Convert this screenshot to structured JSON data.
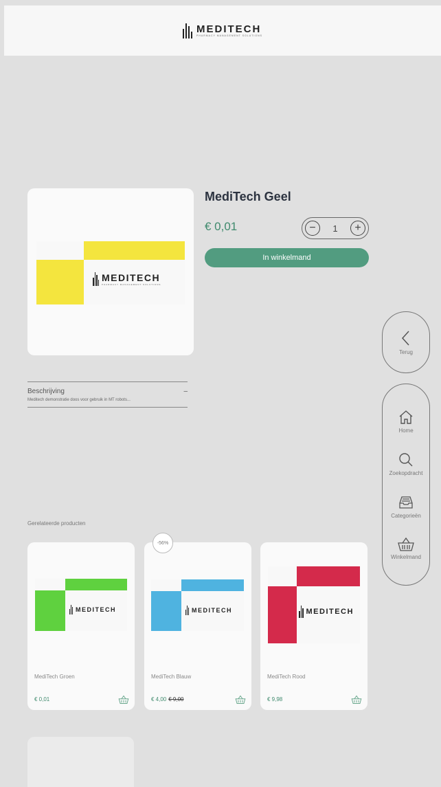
{
  "header": {
    "brand": "MEDITECH",
    "tagline": "PHARMACY MANAGEMENT SOLUTIONS"
  },
  "product": {
    "title": "MediTech Geel",
    "price": "€ 0,01",
    "quantity": "1",
    "add_to_cart_label": "In winkelmand",
    "box_brand": "MEDITECH",
    "box_tagline": "PHARMACY MANAGEMENT SOLUTIONS",
    "accent_color": "#f4e53e"
  },
  "description": {
    "heading": "Beschrijving",
    "toggle": "–",
    "text": "Meditech demonstratie doos voor gebruik in MT robots..."
  },
  "side_nav": {
    "back": {
      "label": "Terug",
      "icon": "chevron-left-icon"
    },
    "items": [
      {
        "label": "Home",
        "icon": "home-icon"
      },
      {
        "label": "Zoekopdracht",
        "icon": "search-icon"
      },
      {
        "label": "Categorieën",
        "icon": "inbox-icon"
      },
      {
        "label": "Winkelmand",
        "icon": "basket-icon"
      }
    ]
  },
  "related": {
    "title": "Gerelateerde producten",
    "discount_badge": "-56%",
    "items": [
      {
        "name": "MediTech Groen",
        "price": "€ 0,01",
        "old_price": "",
        "color": "#5fd13f"
      },
      {
        "name": "MediTech Blauw",
        "price": "€ 4,00",
        "old_price": "€ 9,00",
        "color": "#4fb3e0"
      },
      {
        "name": "MediTech Rood",
        "price": "€ 9,98",
        "old_price": "",
        "color": "#d42a4b"
      }
    ]
  },
  "colors": {
    "brand_green": "#529c80",
    "price_green": "#3f8a6d"
  }
}
